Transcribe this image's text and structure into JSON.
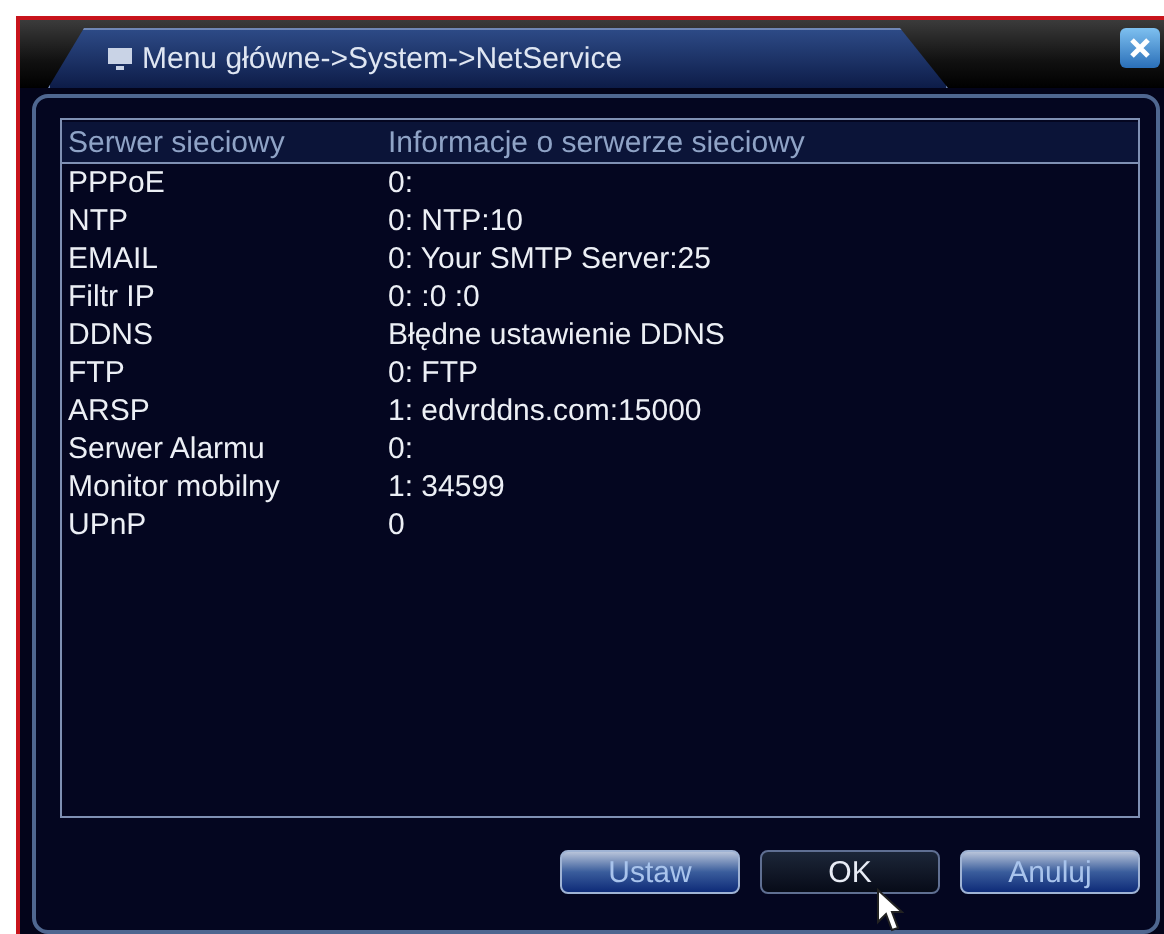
{
  "window": {
    "title": "Menu główne->System->NetService"
  },
  "table": {
    "columns": [
      "Serwer sieciowy",
      "Informacje o serwerze sieciowy"
    ],
    "rows": [
      [
        "PPPoE",
        "0:"
      ],
      [
        "NTP",
        "0: NTP:10"
      ],
      [
        "EMAIL",
        "0: Your SMTP Server:25"
      ],
      [
        "Filtr IP",
        "0: :0 :0"
      ],
      [
        "DDNS",
        "Błędne ustawienie DDNS"
      ],
      [
        "FTP",
        "0: FTP"
      ],
      [
        "ARSP",
        "1: edvrddns.com:15000"
      ],
      [
        "Serwer Alarmu",
        "0:"
      ],
      [
        "Monitor mobilny",
        "1: 34599"
      ],
      [
        "UPnP",
        "0"
      ]
    ]
  },
  "buttons": [
    {
      "label": "Ustaw",
      "selected": false
    },
    {
      "label": "OK",
      "selected": true
    },
    {
      "label": "Anuluj",
      "selected": false
    }
  ]
}
